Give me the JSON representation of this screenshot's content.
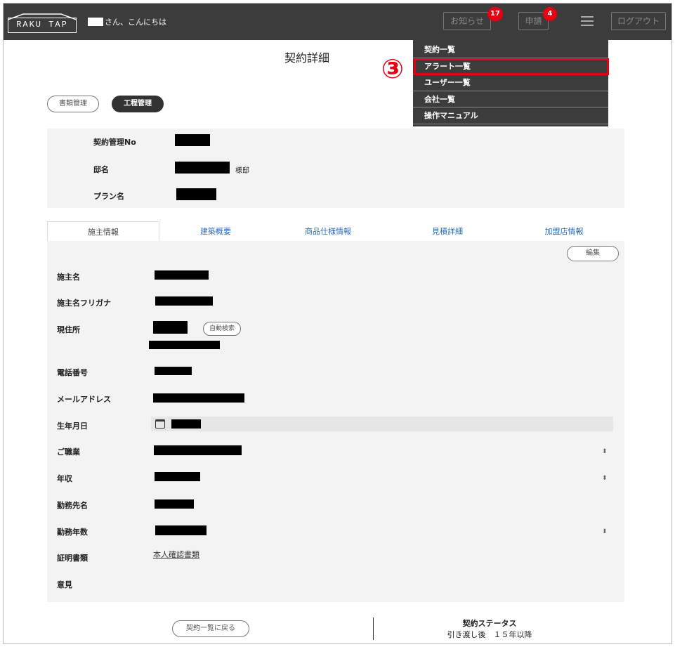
{
  "header": {
    "logo_text": "RAKU TAP",
    "greeting": "さん、こんにちは",
    "notice_label": "お知らせ",
    "notice_count": "17",
    "request_label": "申請",
    "request_count": "4",
    "logout_label": "ログアウト"
  },
  "menu": {
    "items": [
      {
        "label": "契約一覧"
      },
      {
        "label": "アラート一覧"
      },
      {
        "label": "ユーザー一覧"
      },
      {
        "label": "会社一覧"
      },
      {
        "label": "操作マニュアル"
      }
    ],
    "step_marker": "③"
  },
  "page": {
    "title": "契約詳細",
    "doc_mgmt_label": "書類管理",
    "process_mgmt_label": "工程管理"
  },
  "summary": {
    "contract_no_label": "契約管理No",
    "residence_label": "邸名",
    "residence_suffix": "様邸",
    "plan_label": "プラン名"
  },
  "tabs": [
    {
      "label": "施主情報"
    },
    {
      "label": "建築概要"
    },
    {
      "label": "商品仕様情報"
    },
    {
      "label": "見積詳細"
    },
    {
      "label": "加盟店情報"
    }
  ],
  "form": {
    "edit_label": "編集",
    "auto_search_label": "自動検索",
    "fields": [
      {
        "label": "施主名"
      },
      {
        "label": "施主名フリガナ"
      },
      {
        "label": "現住所"
      },
      {
        "label": "電話番号"
      },
      {
        "label": "メールアドレス"
      },
      {
        "label": "生年月日"
      },
      {
        "label": "ご職業"
      },
      {
        "label": "年収"
      },
      {
        "label": "勤務先名"
      },
      {
        "label": "勤務年数"
      },
      {
        "label": "証明書類"
      },
      {
        "label": "意見"
      }
    ],
    "proof_link": "本人確認書類",
    "sort_glyph": "⬍"
  },
  "footer": {
    "back_label": "契約一覧に戻る",
    "status_label": "契約ステータス",
    "status_value": "引き渡し後　１５年以降"
  }
}
